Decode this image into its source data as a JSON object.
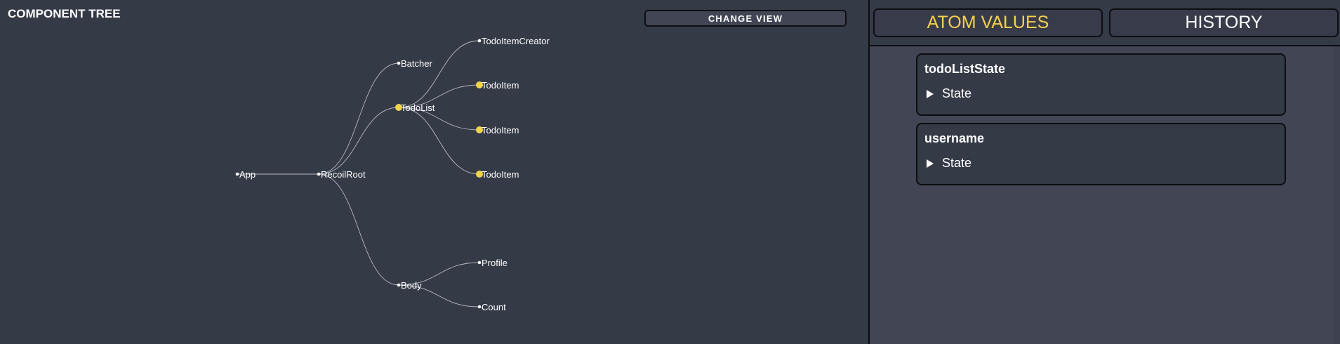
{
  "component_tree": {
    "title": "COMPONENT TREE",
    "change_view_label": "CHANGE VIEW",
    "nodes": [
      {
        "id": "app",
        "label": "App",
        "highlighted": false
      },
      {
        "id": "recoilroot",
        "label": "RecoilRoot",
        "highlighted": false
      },
      {
        "id": "batcher",
        "label": "Batcher",
        "highlighted": false
      },
      {
        "id": "todolist",
        "label": "TodoList",
        "highlighted": true
      },
      {
        "id": "body",
        "label": "Body",
        "highlighted": false
      },
      {
        "id": "todoitemcreator",
        "label": "TodoItemCreator",
        "highlighted": false
      },
      {
        "id": "todoitem1",
        "label": "TodoItem",
        "highlighted": true
      },
      {
        "id": "todoitem2",
        "label": "TodoItem",
        "highlighted": true
      },
      {
        "id": "todoitem3",
        "label": "TodoItem",
        "highlighted": true
      },
      {
        "id": "profile",
        "label": "Profile",
        "highlighted": false
      },
      {
        "id": "count",
        "label": "Count",
        "highlighted": false
      }
    ],
    "edges": [
      [
        "app",
        "recoilroot"
      ],
      [
        "recoilroot",
        "batcher"
      ],
      [
        "recoilroot",
        "todolist"
      ],
      [
        "recoilroot",
        "body"
      ],
      [
        "todolist",
        "todoitemcreator"
      ],
      [
        "todolist",
        "todoitem1"
      ],
      [
        "todolist",
        "todoitem2"
      ],
      [
        "todolist",
        "todoitem3"
      ],
      [
        "body",
        "profile"
      ],
      [
        "body",
        "count"
      ]
    ]
  },
  "tabs": {
    "atom_values_label": "ATOM VALUES",
    "history_label": "HISTORY",
    "active": "atom_values"
  },
  "atoms": [
    {
      "name": "todoListState",
      "state_label": "State"
    },
    {
      "name": "username",
      "state_label": "State"
    }
  ],
  "colors": {
    "highlight": "#f2d34a",
    "link": "#b9bcc6",
    "active_tab_text": "#f7d24a"
  }
}
